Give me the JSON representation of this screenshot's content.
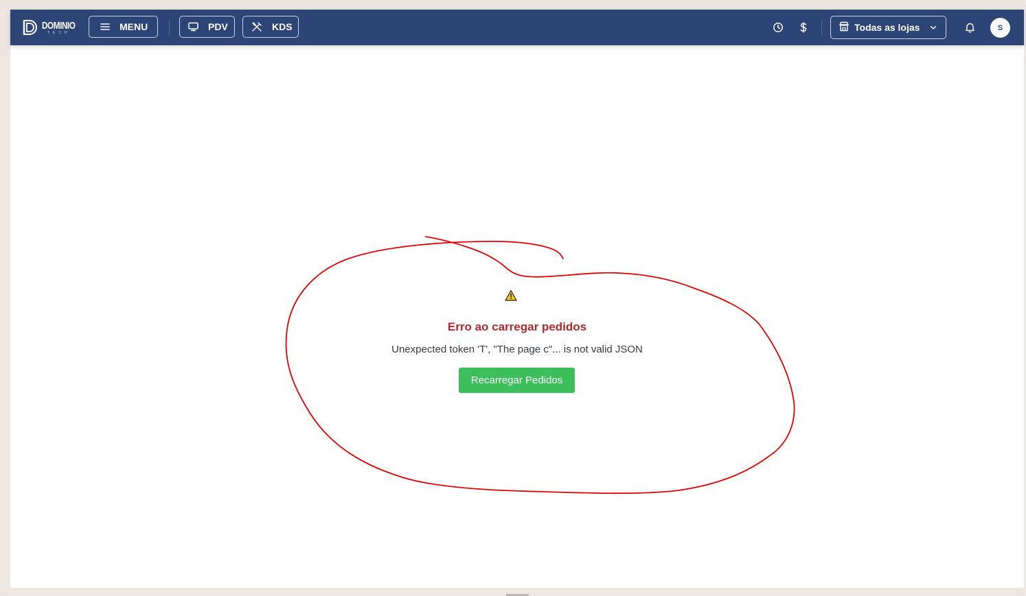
{
  "header": {
    "logo_text": "DOMINIO",
    "logo_sub": "TECH",
    "menu_label": "MENU",
    "pdv_label": "PDV",
    "kds_label": "KDS",
    "store_select_value": "Todas as lojas",
    "avatar_initial": "S",
    "icons": {
      "menu": "hamburger-icon",
      "pdv": "monitor-icon",
      "kds": "utensils-icon",
      "history": "clock-icon",
      "cash": "dollar-icon",
      "store": "store-icon",
      "dropdown": "chevron-down-icon",
      "notifications": "bell-icon"
    }
  },
  "error": {
    "title": "Erro ao carregar pedidos",
    "message": "Unexpected token 'T', \"The page c\"... is not valid JSON",
    "reload_label": "Recarregar Pedidos",
    "icon": "warning-icon"
  },
  "colors": {
    "header_bg": "#2c4476",
    "error_title": "#b02a2a",
    "reload_button": "#3cbf5a",
    "annotation": "#e00000",
    "page_bg": "#ede6e1"
  }
}
